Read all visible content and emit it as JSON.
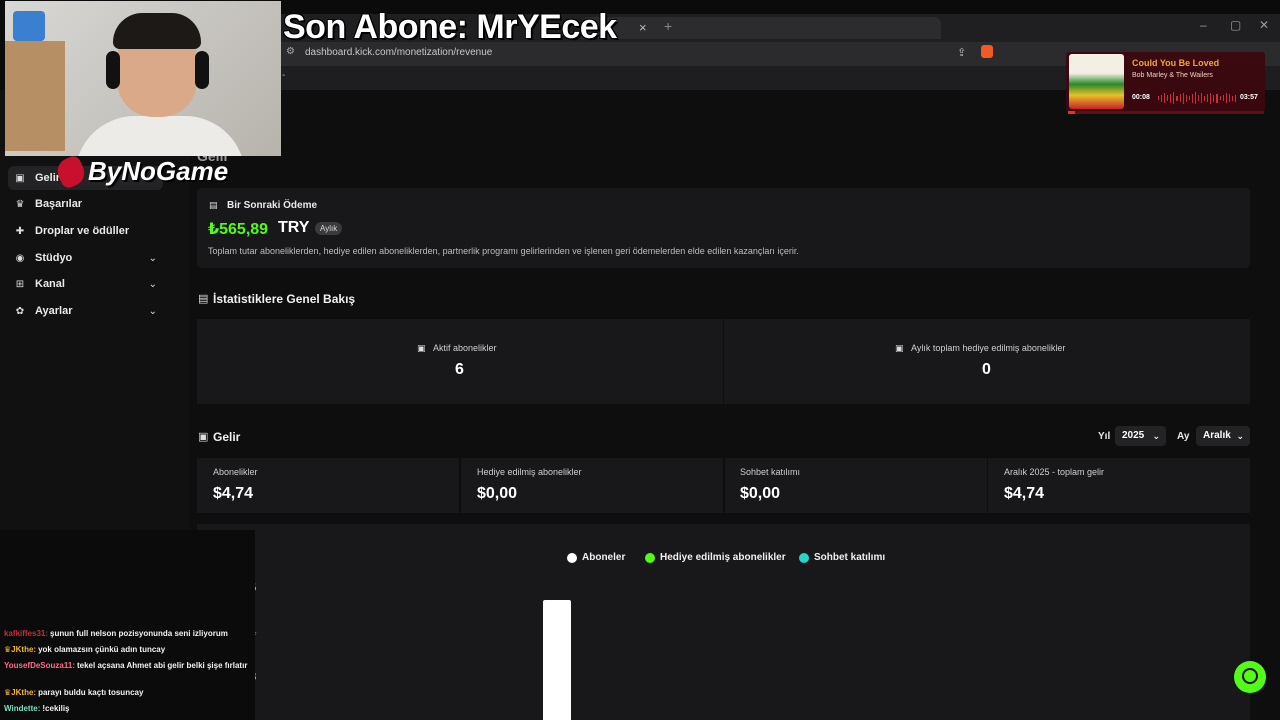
{
  "browser": {
    "url": "dashboard.kick.com/monetization/revenue",
    "tab_close": "×",
    "tab_new": "+",
    "win_min": "–",
    "win_max": "▢",
    "win_close": "✕"
  },
  "overlay": {
    "stream_title": "Son Abone: MrYEcek",
    "logo_text": "ByNoGame",
    "now_playing": {
      "title": "Could You Be Loved",
      "artist": "Bob Marley & The Wailers",
      "elapsed": "00:08",
      "duration": "03:57",
      "progress": 0.034
    }
  },
  "sidebar": {
    "items": [
      {
        "label": "Gelir",
        "icon": "bar-chart-icon",
        "expandable": false
      },
      {
        "label": "Başarılar",
        "icon": "trophy-icon",
        "expandable": false
      },
      {
        "label": "Droplar ve ödüller",
        "icon": "gift-icon",
        "expandable": false
      },
      {
        "label": "Stüdyo",
        "icon": "studio-icon",
        "expandable": true
      },
      {
        "label": "Kanal",
        "icon": "broadcast-icon",
        "expandable": true
      },
      {
        "label": "Ayarlar",
        "icon": "gear-icon",
        "expandable": true
      }
    ]
  },
  "page": {
    "title": "Gelir"
  },
  "payment": {
    "heading": "Bir Sonraki Ödeme",
    "amount": "₺565,89",
    "currency": "TRY",
    "badge": "Aylık",
    "description": "Toplam tutar aboneliklerden, hediye edilen aboneliklerden, partnerlik programı gelirlerinden ve işlenen geri ödemelerden elde edilen kazançları içerir."
  },
  "stats": {
    "heading": "İstatistiklere Genel Bakış",
    "cells": [
      {
        "label": "Aktif abonelikler",
        "value": "6"
      },
      {
        "label": "Aylık toplam hediye edilmiş abonelikler",
        "value": "0"
      }
    ]
  },
  "revenue": {
    "heading": "Gelir",
    "year_label": "Yıl",
    "year_value": "2025",
    "month_label": "Ay",
    "month_value": "Aralık",
    "cells": [
      {
        "label": "Abonelikler",
        "value": "$4,74"
      },
      {
        "label": "Hediye edilmiş abonelikler",
        "value": "$0,00"
      },
      {
        "label": "Sohbet katılımı",
        "value": "$0,00"
      },
      {
        "label": "Aralık 2025 - toplam gelir",
        "value": "$4,74"
      }
    ]
  },
  "chart_data": {
    "type": "bar",
    "series": [
      {
        "name": "Aboneler",
        "color": "#ffffff",
        "values": [
          4.74
        ]
      },
      {
        "name": "Hediye edilmiş abonelikler",
        "color": "#53fc18",
        "values": [
          0
        ]
      },
      {
        "name": "Sohbet katılımı",
        "color": "#24d6c8",
        "values": [
          0
        ]
      }
    ],
    "yticks": [
      "$5",
      "$4",
      "$3"
    ],
    "legend_position": "top-center"
  },
  "chat": [
    {
      "user": "kafkiffes31:",
      "user_color": "#c0303a",
      "crown": false,
      "message": "şunun full nelson pozisyonunda seni izliyorum"
    },
    {
      "user": "JKthe:",
      "user_color": "#f2b632",
      "crown": true,
      "message": "yok olamazsın çünkü adın tuncay"
    },
    {
      "user": "YousefDeSouza11:",
      "user_color": "#ff6b8b",
      "crown": false,
      "message": "tekel açsana Ahmet abi gelir belki şişe fırlatır"
    },
    {
      "user": "JKthe:",
      "user_color": "#f2b632",
      "crown": true,
      "message": "parayı buldu kaçtı tosuncay"
    },
    {
      "user": "Windette:",
      "user_color": "#7fe0c0",
      "crown": false,
      "message": "!cekiliş"
    }
  ],
  "colors": {
    "accent": "#53fc18",
    "background": "#0e0e0f",
    "card": "#18181a"
  }
}
